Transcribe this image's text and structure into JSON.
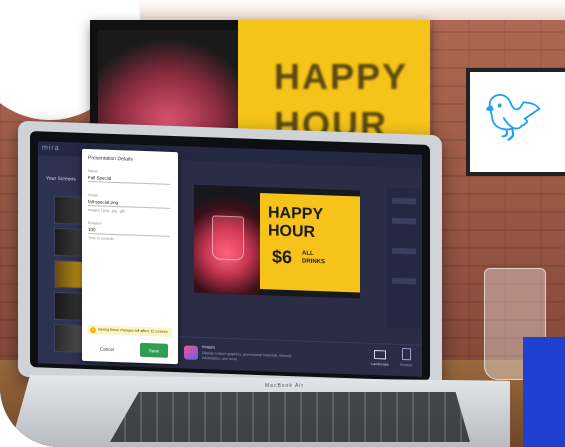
{
  "app": {
    "logo": "mira"
  },
  "sidebar": {
    "title": "Your Screens"
  },
  "panel": {
    "title": "Presentation Details",
    "fields": [
      {
        "label": "Name",
        "value": "Fall Special"
      },
      {
        "label": "Image",
        "value": "fall-special.png"
      },
      {
        "label": "",
        "value": "Images (.png, .jpg, .gif)"
      },
      {
        "label": "Duration",
        "value": "100"
      },
      {
        "label": "",
        "value": "Time in seconds"
      }
    ],
    "notice_text": "Saving these changes will affect 32 screens",
    "cancel_label": "Cancel",
    "save_label": "Save"
  },
  "preview": {
    "line1": "HAPPY",
    "line2": "HOUR",
    "price": "$6",
    "price_sub1": "ALL",
    "price_sub2": "DRINKS"
  },
  "bottom_bar": {
    "app_title": "Images",
    "app_desc": "Display custom graphics, promotional materials, themed information, and more.",
    "orientation_landscape": "Landscape",
    "orientation_portrait": "Portrait"
  },
  "background": {
    "poster_line1": "HAPPY",
    "poster_line2": "HOUR"
  },
  "laptop": {
    "brand": "MacBook Air"
  },
  "colors": {
    "accent_yellow": "#f6c31a",
    "save_green": "#2e9e53",
    "screen_bg": "#2a2d45",
    "corner_blue": "#1f3fd0"
  }
}
